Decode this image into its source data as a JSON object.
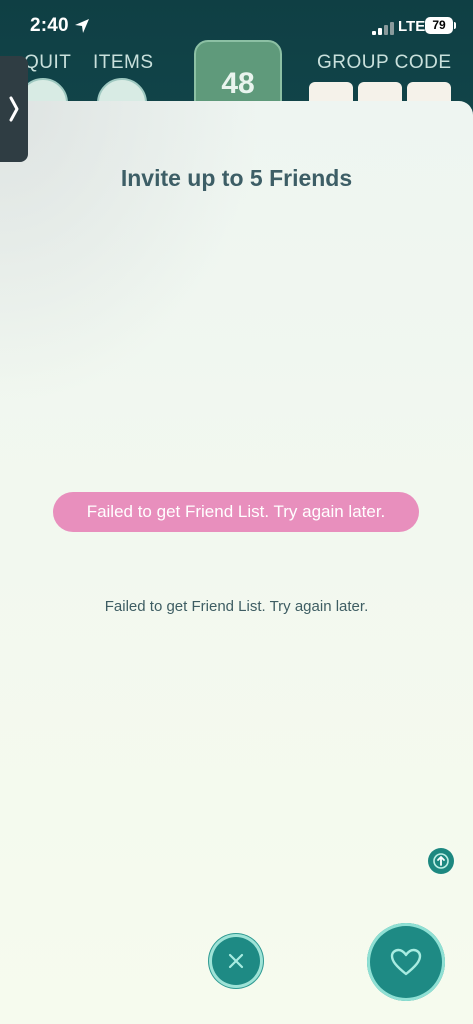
{
  "status_bar": {
    "time": "2:40",
    "network": "LTE",
    "battery": "79"
  },
  "lobby": {
    "quit_label": "QUIT",
    "items_label": "ITEMS",
    "player_count": "48",
    "group_code_label": "GROUP CODE"
  },
  "side_tab": {
    "icon": "chevron-right-icon"
  },
  "modal": {
    "title": "Invite up to 5 Friends",
    "toast": "Failed to get Friend List. Try again later.",
    "message": "Failed to get Friend List. Try again later.",
    "close_icon": "close-icon",
    "invite_icon": "heart-icon",
    "send_icon": "arrow-up-icon"
  },
  "colors": {
    "toast_bg": "#e88fbd",
    "title_text": "#3d5e66",
    "button_teal": "#1e8a84"
  }
}
